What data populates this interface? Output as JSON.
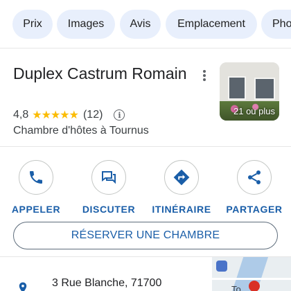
{
  "chips": [
    "Prix",
    "Images",
    "Avis",
    "Emplacement",
    "Pho"
  ],
  "place": {
    "title": "Duplex Castrum Romain",
    "rating": "4,8",
    "stars": "★★★★★",
    "review_count": "(12)",
    "category": "Chambre d'hôtes à Tournus",
    "photo_label": "21 ou plus"
  },
  "actions": [
    {
      "label": "APPELER",
      "icon": "phone-icon"
    },
    {
      "label": "DISCUTER",
      "icon": "chat-icon"
    },
    {
      "label": "ITINÉRAIRE",
      "icon": "directions-icon"
    },
    {
      "label": "PARTAGER",
      "icon": "share-icon"
    }
  ],
  "reserve_label": "RÉSERVER UNE CHAMBRE",
  "address": "3 Rue Blanche, 71700",
  "map_label": "To",
  "colors": {
    "accent": "#1a5ea8",
    "chip_bg": "#e8effc",
    "star": "#fbbc04"
  }
}
